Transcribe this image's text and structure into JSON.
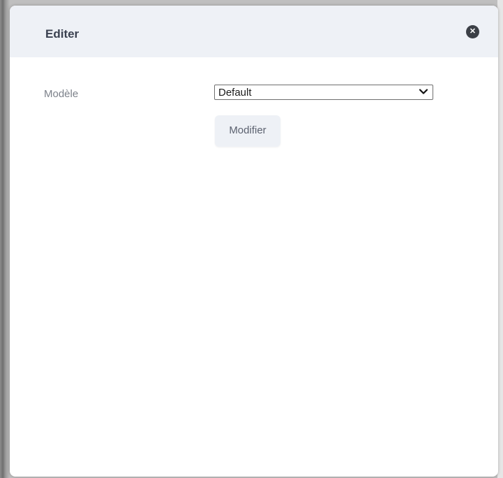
{
  "dialog": {
    "title": "Editer",
    "close_icon": "close-icon",
    "close_glyph": "✕"
  },
  "form": {
    "model_label": "Modèle",
    "model_selected": "Default",
    "select_icon": "chevron-down-icon",
    "modify_label": "Modifier"
  }
}
